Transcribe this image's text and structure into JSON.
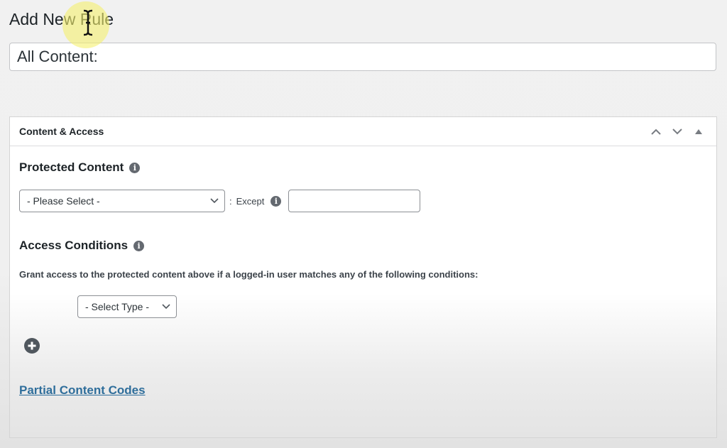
{
  "page": {
    "title": "Add New Rule",
    "title_input_value": "All Content:"
  },
  "postbox": {
    "title": "Content & Access",
    "actions": [
      {
        "name": "move-up",
        "icon": "chevron-up-icon"
      },
      {
        "name": "move-down",
        "icon": "chevron-down-icon"
      },
      {
        "name": "toggle-panel",
        "icon": "triangle-up-icon"
      }
    ]
  },
  "protected_content": {
    "heading": "Protected Content",
    "select_value": "- Please Select -",
    "separator": ":",
    "except_label": "Except",
    "except_value": ""
  },
  "access_conditions": {
    "heading": "Access Conditions",
    "description": "Grant access to the protected content above if a logged-in user matches any of the following conditions:",
    "type_select_value": "- Select Type -"
  },
  "partial_content_link": "Partial Content Codes",
  "colors": {
    "link": "#2f6e9b",
    "icon_gray": "#646970",
    "cursor_highlight": "#f5f06e"
  }
}
